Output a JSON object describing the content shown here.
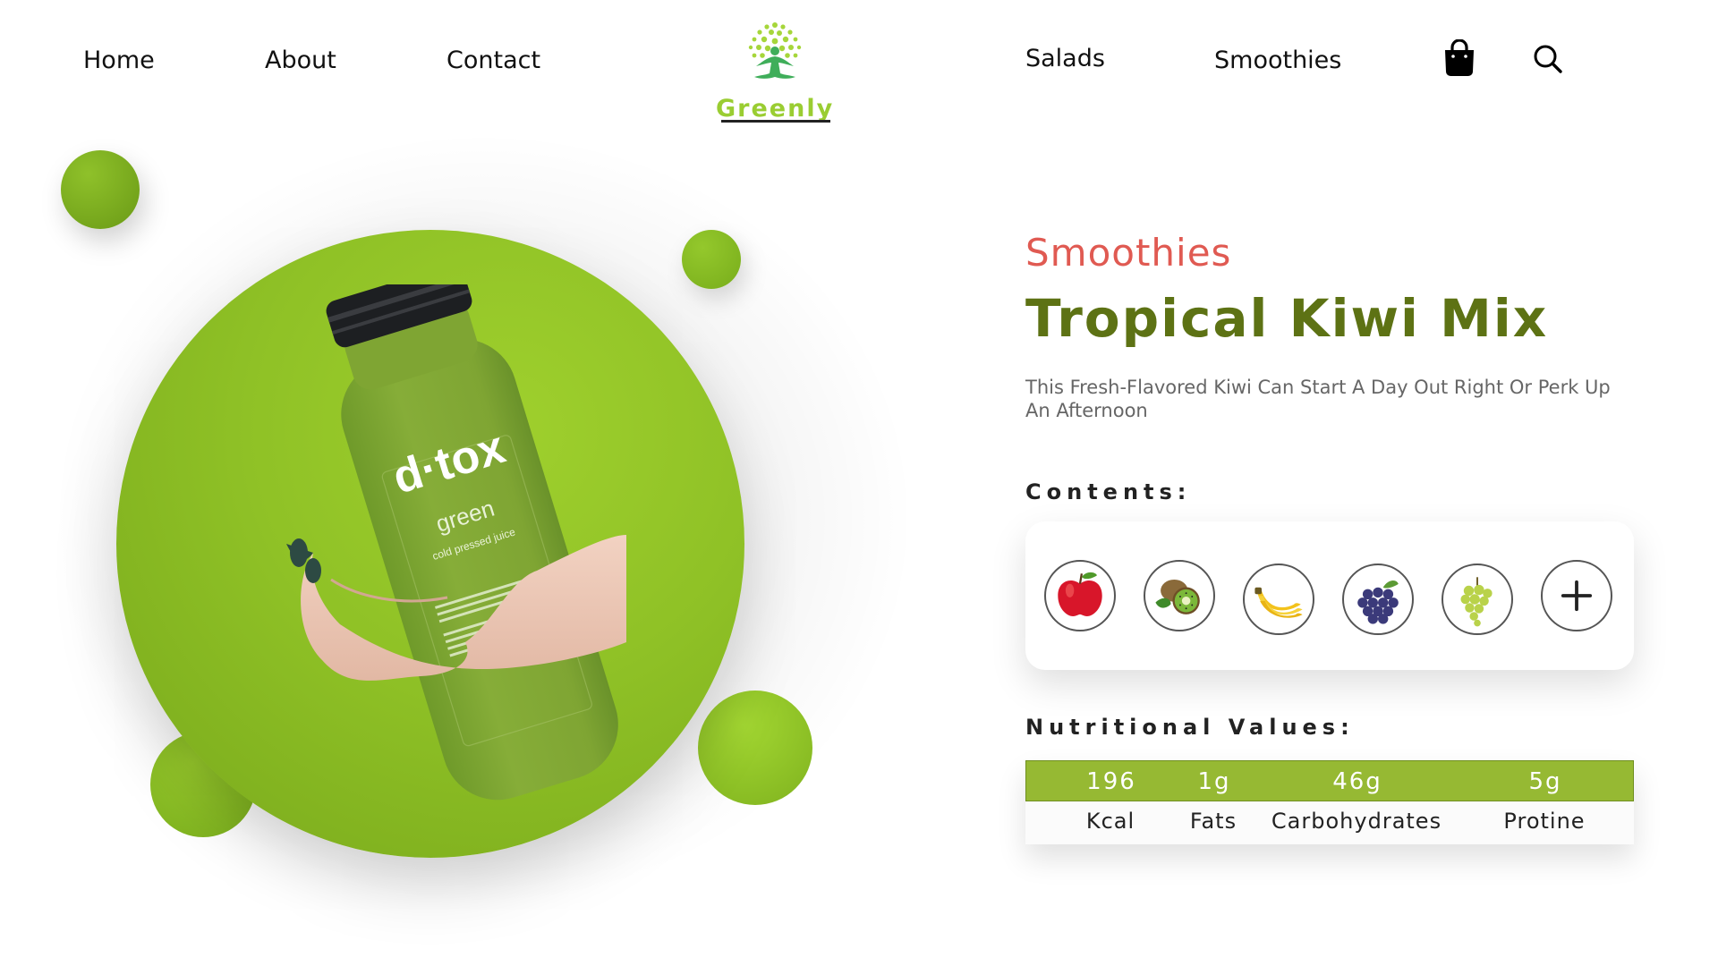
{
  "nav": {
    "home": "Home",
    "about": "About",
    "contact": "Contact",
    "salads": "Salads",
    "smoothies": "Smoothies",
    "cart_icon": "shopping-bag-icon",
    "search_icon": "search-icon"
  },
  "logo": {
    "text": "Greenly",
    "icon": "tree-person-icon"
  },
  "product": {
    "category": "Smoothies",
    "title": "Tropical Kiwi Mix",
    "description": "This Fresh-Flavored Kiwi Can Start A Day Out Right Or Perk Up An Afternoon",
    "bottle": {
      "brand": "d·tox",
      "variant": "green",
      "tagline": "cold pressed juice"
    }
  },
  "contents": {
    "heading": "Contents:",
    "items": [
      {
        "icon": "apple-icon"
      },
      {
        "icon": "kiwi-icon"
      },
      {
        "icon": "banana-icon"
      },
      {
        "icon": "red-grapes-icon"
      },
      {
        "icon": "green-grapes-icon"
      },
      {
        "icon": "add-icon"
      }
    ]
  },
  "nutrition": {
    "heading": "Nutritional Values:",
    "items": [
      {
        "value": "196",
        "label": "Kcal"
      },
      {
        "value": "1g",
        "label": "Fats"
      },
      {
        "value": "46g",
        "label": "Carbohydrates"
      },
      {
        "value": "5g",
        "label": "Protine"
      }
    ]
  },
  "colors": {
    "accent_green": "#96b933",
    "title_green": "#5d7214",
    "category_red": "#e05a52",
    "logo_green": "#9acd32"
  }
}
